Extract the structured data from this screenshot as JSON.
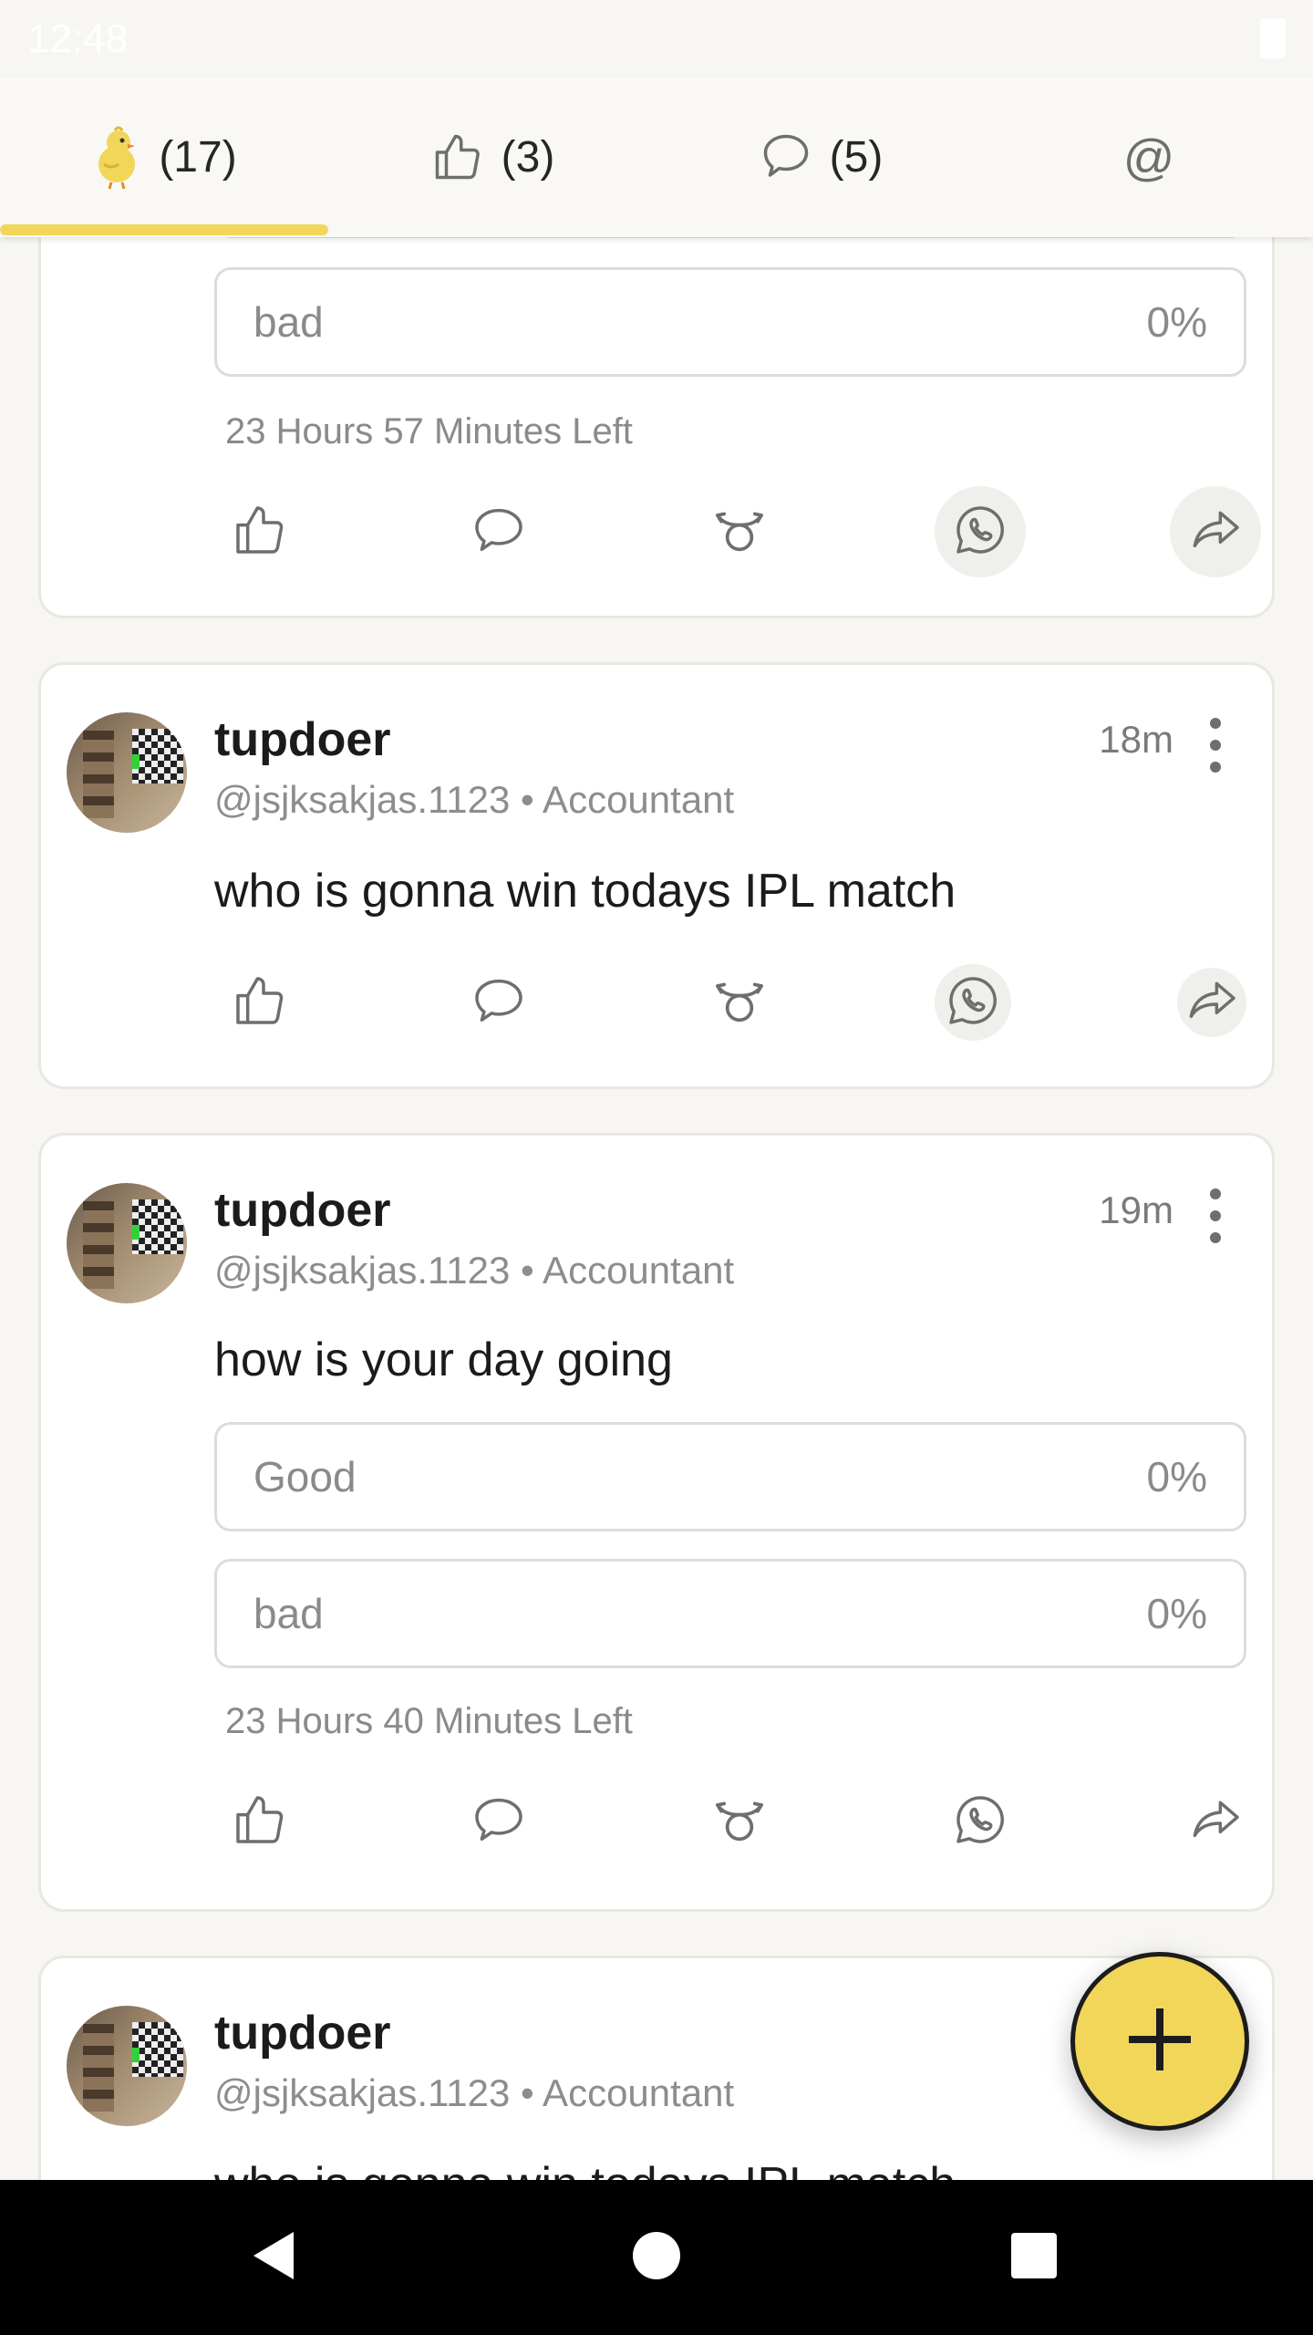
{
  "status_bar": {
    "time": "12:48"
  },
  "tabs": [
    {
      "icon": "chick-icon",
      "label": "(17)",
      "active": true
    },
    {
      "icon": "thumbs-up-icon",
      "label": "(3)",
      "active": false
    },
    {
      "icon": "comment-icon",
      "label": "(5)",
      "active": false
    },
    {
      "icon": "at-icon",
      "label": "@",
      "active": false
    }
  ],
  "posts": [
    {
      "poll": [
        {
          "label": "bad",
          "percent": "0%"
        }
      ],
      "time_left": "23 Hours 57 Minutes Left"
    },
    {
      "username": "tupdoer",
      "handle": "@jsjksakjas.1123 • Accountant",
      "time": "18m",
      "text": "who is gonna win todays IPL match"
    },
    {
      "username": "tupdoer",
      "handle": "@jsjksakjas.1123 • Accountant",
      "time": "19m",
      "text": "how is your day going",
      "poll": [
        {
          "label": "Good",
          "percent": "0%"
        },
        {
          "label": "bad",
          "percent": "0%"
        }
      ],
      "time_left": "23 Hours 40 Minutes Left"
    },
    {
      "username": "tupdoer",
      "handle": "@jsjksakjas.1123 • Accountant",
      "text": "who is gonna win todays IPL match"
    }
  ],
  "action_icons": [
    "like-icon",
    "comment-icon",
    "gift-icon",
    "whatsapp-icon",
    "share-icon"
  ],
  "fab": {
    "icon": "plus-icon"
  },
  "colors": {
    "accent": "#f2d65a",
    "background": "#f7f6f3",
    "card": "#ffffff"
  }
}
